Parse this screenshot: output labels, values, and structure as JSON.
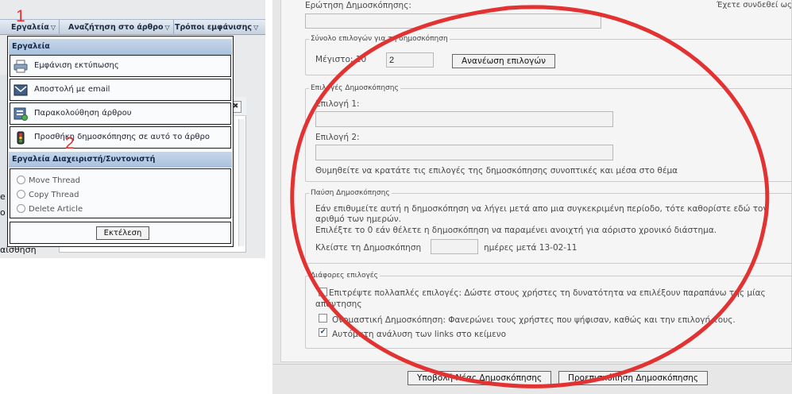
{
  "annotations": {
    "step1": "1",
    "step2": "2"
  },
  "left": {
    "navbar": {
      "items": [
        {
          "label": "Εργαλεία"
        },
        {
          "label": "Αναζήτηση στο άρθρο"
        },
        {
          "label": "Τρόποι εμφάνισης"
        }
      ],
      "chevron": "▽"
    },
    "background": {
      "partial_text": "αίσθηση",
      "close_glyph": "✖"
    },
    "tools_menu": {
      "header": "Εργαλεία",
      "items": [
        {
          "label": "Εμφάνιση εκτύπωσης",
          "icon": "printer-icon"
        },
        {
          "label": "Αποστολή με email",
          "icon": "email-icon"
        },
        {
          "label": "Παρακολούθηση άρθρου",
          "icon": "subscribe-icon"
        },
        {
          "label": "Προσθήκη δημοσκόπησης σε αυτό το άρθρο",
          "icon": "poll-icon"
        }
      ],
      "mod_header": "Εργαλεία Διαχειριστή/Συντονιστή",
      "mod_options": [
        {
          "label": "Move Thread"
        },
        {
          "label": "Copy Thread"
        },
        {
          "label": "Delete Article"
        }
      ],
      "execute_label": "Εκτέλεση"
    }
  },
  "right": {
    "question_label": "Ερώτηση Δημοσκόπησης:",
    "logged_in_text": "Έχετε συνδεθεί ως",
    "options_count": {
      "legend": "Σύνολο επιλογών για τη δημοσκόπηση",
      "max_label": "Μέγιστο: 10",
      "value": "2",
      "refresh_button": "Ανανέωση επιλογών"
    },
    "poll_options": {
      "legend": "Επιλογές Δημοσκόπησης",
      "option1_label": "Επιλογή 1:",
      "option2_label": "Επιλογή 2:",
      "hint": "Θυμηθείτε να κρατάτε τις επιλογές της δημοσκόπησης συνοπτικές και μέσα στο θέμα"
    },
    "poll_timeout": {
      "legend": "Παύση Δημοσκόπησης",
      "line1": "Εάν επιθυμείτε αυτή η δημοσκόπηση να λήγει μετά απο μια συγκεκριμένη περίοδο, τότε καθορίστε εδώ τον",
      "line2": "αριθμό των ημερών.",
      "line3": "Επιλέξτε το 0 εάν θέλετε η δημοσκόπηση να παραμένει ανοιχτή για αόριστο χρονικό διάστημα.",
      "close_label": "Κλείστε τη Δημοσκόπηση",
      "days_suffix": "ημέρες μετά 13-02-11"
    },
    "misc": {
      "legend": "Διάφορες επιλογές",
      "opt_multiple_1": "Επιτρέψτε πολλαπλές επιλογές: Δώστε στους χρήστες τη δυνατότητα να επιλέξουν παραπάνω της μίας",
      "opt_multiple_2": "απάντησης",
      "opt_public": "Ονομαστική Δημοσκόπηση: Φανερώνει τους χρήστες που ψήφισαν, καθώς και την επιλογή τους.",
      "opt_autolinks": "Αυτόματη ανάλυση των links στο κείμενο",
      "check_mark": "✔"
    },
    "submit_button": "Υποβολή Νέας Δημοσκόπησης",
    "preview_button": "Προεπισκόπηση Δημοσκόπησης"
  },
  "colors": {
    "annotation": "#e23232",
    "menu_header": "#b8cbe2"
  }
}
